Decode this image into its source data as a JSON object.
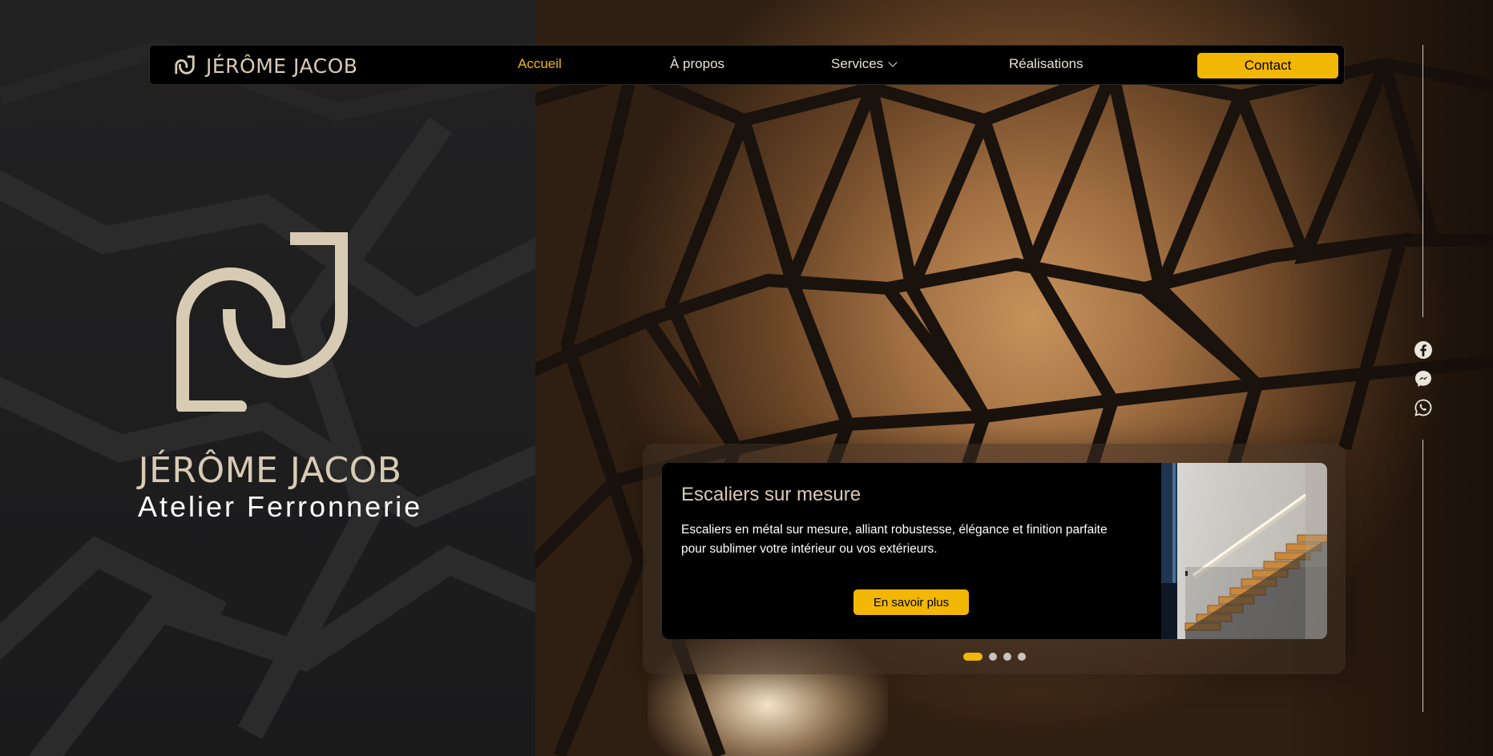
{
  "brand": {
    "name": "JÉRÔME JACOB",
    "logo_icon": "jj-monogram-icon"
  },
  "nav": {
    "items": [
      {
        "label": "Accueil",
        "active": true
      },
      {
        "label": "À propos",
        "active": false
      },
      {
        "label": "Services",
        "active": false,
        "has_dropdown": true
      },
      {
        "label": "Réalisations",
        "active": false
      }
    ],
    "contact_label": "Contact"
  },
  "hero": {
    "name": "JÉRÔME JACOB",
    "subtitle": "Atelier Ferronnerie"
  },
  "social": [
    {
      "icon": "facebook-icon"
    },
    {
      "icon": "messenger-icon"
    },
    {
      "icon": "whatsapp-icon"
    }
  ],
  "slider": {
    "title": "Escaliers sur mesure",
    "text": "Escaliers en métal sur mesure, alliant robustesse, élégance et finition parfaite pour sublimer votre intérieur ou vos extérieurs.",
    "cta_label": "En savoir plus",
    "slides_count": 4,
    "active_slide": 1
  },
  "colors": {
    "accent": "#f2b705",
    "brand_beige": "#d8cbb3",
    "nav_bg": "#000000"
  }
}
